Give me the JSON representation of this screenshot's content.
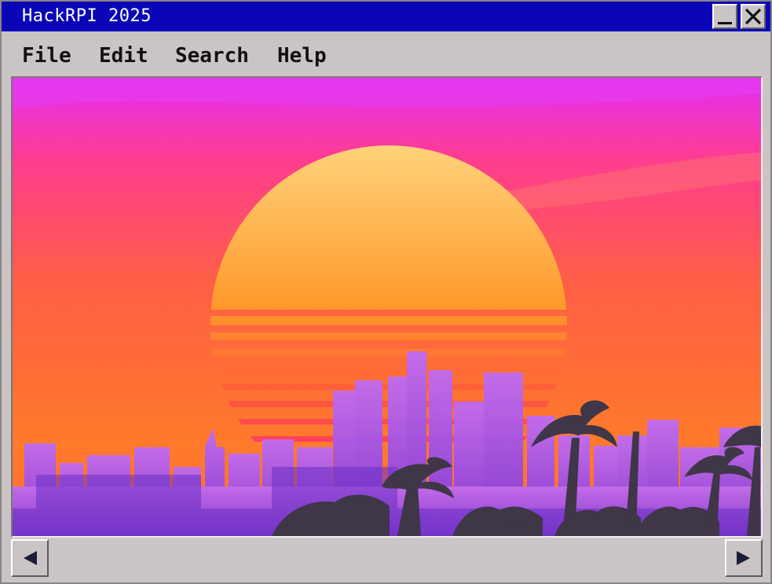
{
  "window": {
    "title": "HackRPI 2025",
    "minimize_icon": "minimize-icon",
    "close_icon": "close-icon"
  },
  "menubar": {
    "items": [
      {
        "label": "File"
      },
      {
        "label": "Edit"
      },
      {
        "label": "Search"
      },
      {
        "label": "Help"
      }
    ]
  },
  "image": {
    "alt": "Synthwave sunset over a city skyline with palm trees",
    "colors": {
      "sky_top": "#e22ef4",
      "sky_mid": "#ff4d62",
      "sky_low": "#ff7a2a",
      "sun_top": "#ffd27a",
      "sun_bottom": "#ff1f8c",
      "city": "#9b3ee8",
      "palms": "#3f3648"
    }
  },
  "scrollbar": {
    "left_icon": "arrow-left-icon",
    "right_icon": "arrow-right-icon"
  },
  "theme": {
    "titlebar_bg": "#0a06b8",
    "chrome_bg": "#cac4c4"
  }
}
